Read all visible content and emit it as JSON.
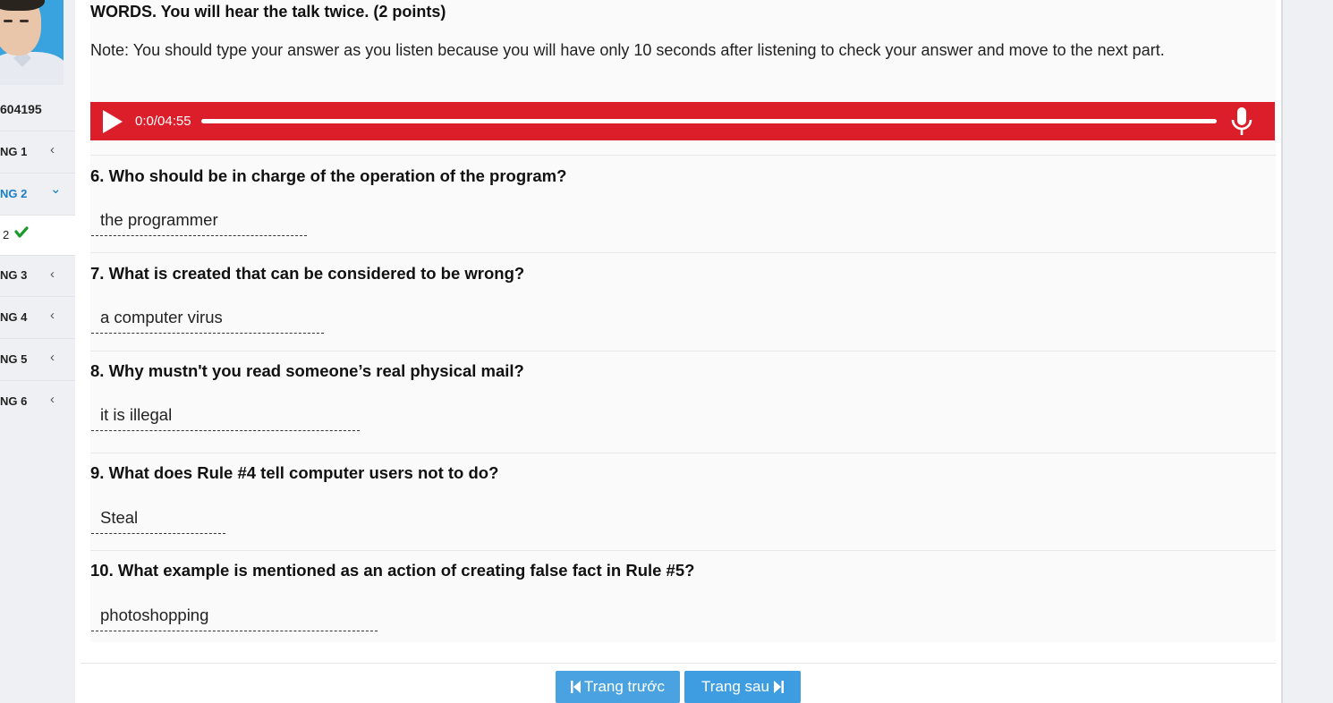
{
  "sidebar": {
    "student_id": "604195",
    "items": [
      {
        "label": "NG 1",
        "chevron": "‹"
      },
      {
        "label": "NG 2",
        "chevron": "⌄"
      },
      {
        "label": "NG 3",
        "chevron": "‹"
      },
      {
        "label": "NG 4",
        "chevron": "‹"
      },
      {
        "label": "NG 5",
        "chevron": "‹"
      },
      {
        "label": "NG 6",
        "chevron": "‹"
      }
    ],
    "sub_item": {
      "label": "2",
      "icon": "check-icon",
      "icon_color": "#1a9a2b"
    },
    "active_color": "#1a7ec8"
  },
  "instructions": {
    "heading": "WORDS. You will hear the talk twice. (2 points)",
    "note": "Note: You should type your answer as you listen because you will have only 10 seconds after listening to check your answer and move to the next part."
  },
  "audio": {
    "time": "0:0/04:55",
    "progress": 0,
    "bar_color": "#dc1e2a"
  },
  "questions": [
    {
      "title": "6. Who should be in charge of the operation of the program?",
      "answer": "the programmer"
    },
    {
      "title": "7. What is created that can be considered to be wrong?",
      "answer": "a computer virus"
    },
    {
      "title": "8. Why mustn't you read someone’s real physical mail?",
      "answer": "it is illegal"
    },
    {
      "title": "9. What does Rule #4 tell computer users not to do?",
      "answer": "Steal"
    },
    {
      "title": "10. What example is mentioned as an action of creating false fact in Rule #5?",
      "answer": "photoshopping"
    }
  ],
  "footer": {
    "prev_label": "Trang trước",
    "next_label": "Trang sau",
    "button_color": "#4aa3e0"
  }
}
